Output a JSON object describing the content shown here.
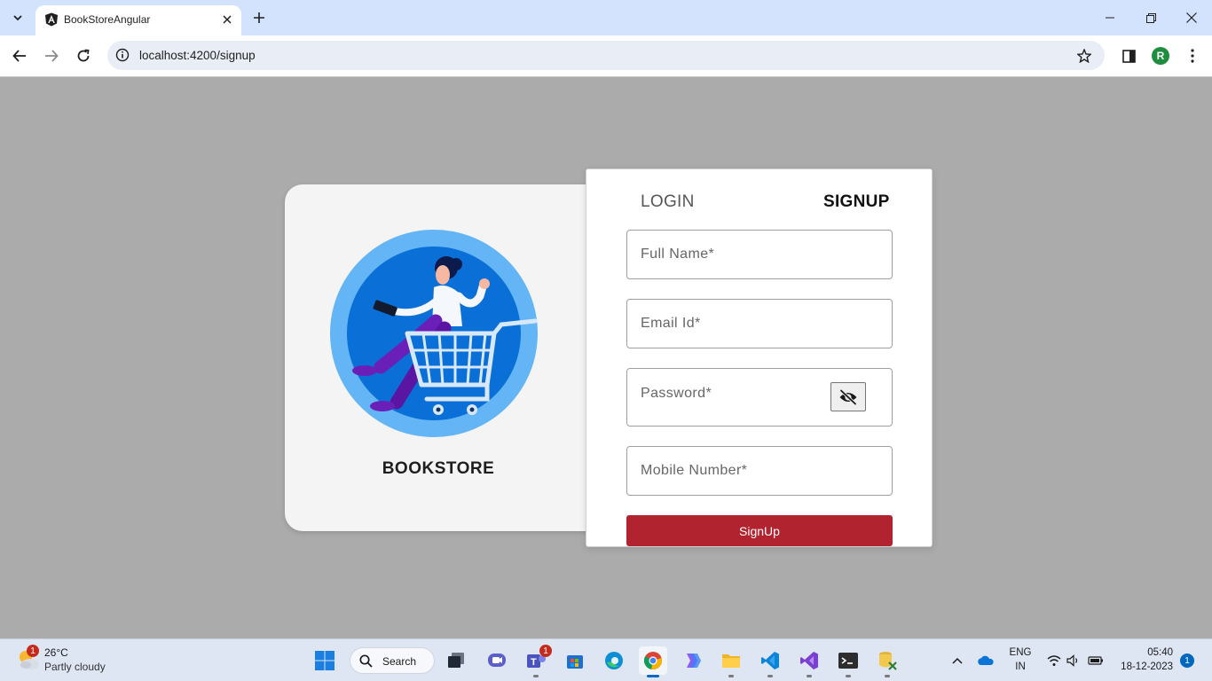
{
  "browser": {
    "tab_title": "BookStoreAngular",
    "url": "localhost:4200/signup",
    "profile_initial": "R",
    "icons": [
      "tab-search-icon",
      "angular-favicon-icon",
      "close-icon",
      "plus-icon",
      "minimize-icon",
      "restore-icon",
      "window-close-icon",
      "back-icon",
      "forward-icon",
      "reload-icon",
      "site-info-icon",
      "star-icon",
      "side-panel-icon",
      "more-icon"
    ]
  },
  "page": {
    "brand": "BOOKSTORE",
    "illustration": "woman-in-shopping-cart-illustration",
    "tabs": {
      "login": "LOGIN",
      "signup": "SIGNUP"
    },
    "fields": {
      "full_name": {
        "placeholder": "Full Name*",
        "value": ""
      },
      "email": {
        "placeholder": "Email Id*",
        "value": ""
      },
      "password": {
        "placeholder": "Password*",
        "value": ""
      },
      "mobile": {
        "placeholder": "Mobile Number*",
        "value": ""
      }
    },
    "password_toggle_icon": "eye-slash-icon",
    "signup_button": "SignUp",
    "colors": {
      "background": "#ababab",
      "button": "#b0232f",
      "left_card": "#f4f4f4"
    }
  },
  "taskbar": {
    "weather_temp": "26°C",
    "weather_condition": "Partly cloudy",
    "weather_badge": "1",
    "search_label": "Search",
    "teams_badge": "1",
    "lang_top": "ENG",
    "lang_bottom": "IN",
    "time": "05:40",
    "date": "18-12-2023",
    "notification_count": "1",
    "apps": [
      "windows-start-icon",
      "task-view-icon",
      "meet-icon",
      "teams-icon",
      "store-icon",
      "edge-icon",
      "chrome-icon",
      "copilot-icon",
      "file-explorer-icon",
      "vscode-icon",
      "visual-studio-icon",
      "terminal-icon",
      "database-tool-icon"
    ]
  }
}
